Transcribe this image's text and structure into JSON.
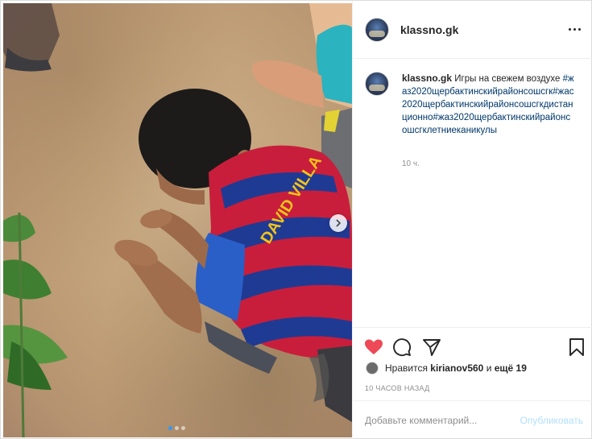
{
  "post": {
    "username": "klassno.gk",
    "caption_text": "Игры на свежем воздухе",
    "caption_tags": "#жаз2020щербактинскийрайонсошсгк#жас2020щербактинскийрайонсошсгкдистанционно#жаз2020щербактинскийрайонсошсгклетниеканикулы",
    "time_short": "10 ч.",
    "likes_prefix": "Нравится",
    "likes_user": "kirianov560",
    "likes_and": "и",
    "likes_more": "ещё 19",
    "timestamp": "10 ЧАСОВ НАЗАД",
    "comment_placeholder": "Добавьте комментарий...",
    "publish_label": "Опубликовать",
    "jersey_text": "DAVID VILLA",
    "carousel": {
      "slides": 3,
      "active": 0
    }
  },
  "colors": {
    "heart": "#ed4956",
    "tag_link": "#00376b",
    "publish_disabled": "#b2dffc",
    "jersey_red": "#c81e3c",
    "jersey_blue": "#1f3a93",
    "jersey_text": "#f2c21b"
  },
  "icons": {
    "like": "heart-icon",
    "comment": "comment-icon",
    "share": "share-icon",
    "save": "bookmark-icon",
    "more": "more-icon",
    "next": "chevron-right-icon"
  }
}
